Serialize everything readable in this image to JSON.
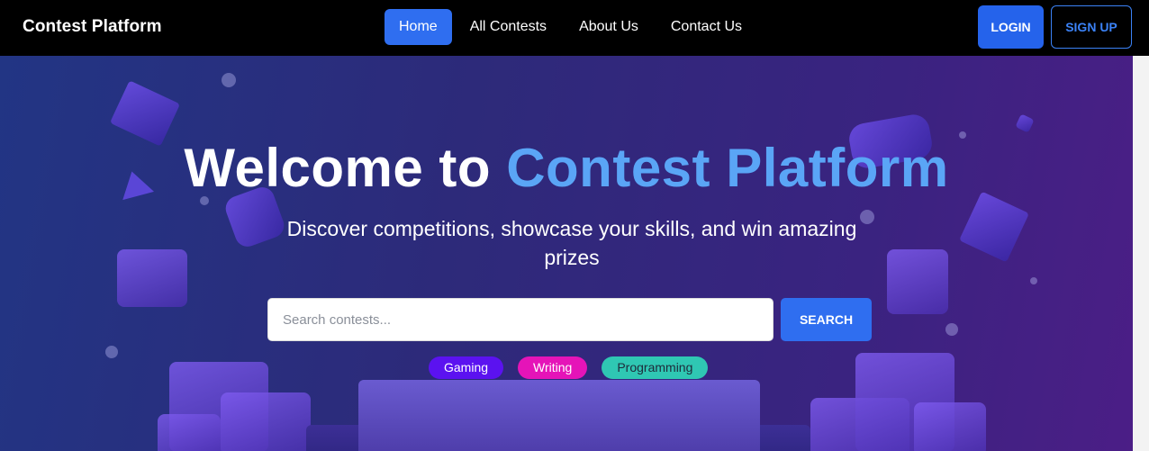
{
  "navbar": {
    "brand": "Contest Platform",
    "links": [
      "Home",
      "All Contests",
      "About Us",
      "Contact Us"
    ],
    "login_label": "LOGIN",
    "signup_label": "SIGN UP"
  },
  "hero": {
    "title_prefix": "Welcome to ",
    "title_accent": "Contest Platform",
    "subtitle": "Discover competitions, showcase your skills, and win amazing prizes",
    "search_placeholder": "Search contests...",
    "search_button": "SEARCH",
    "tags": [
      {
        "label": "Gaming",
        "color": "#5b12f0",
        "text_color": "#ffffff"
      },
      {
        "label": "Writing",
        "color": "#e514b8",
        "text_color": "#ffffff"
      },
      {
        "label": "Programming",
        "color": "#2fc7b3",
        "text_color": "#1e2a3a"
      }
    ]
  },
  "colors": {
    "primary": "#2f6ef0",
    "accent_text": "#5aa5f6"
  }
}
